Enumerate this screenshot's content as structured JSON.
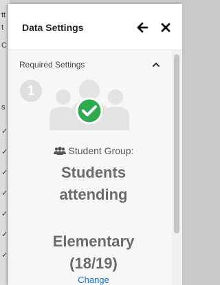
{
  "panel": {
    "title": "Data Settings",
    "back_icon": "arrow-left-icon",
    "close_icon": "close-icon"
  },
  "section": {
    "label": "Required Settings",
    "collapse_icon": "chevron-up-icon",
    "step_number": "1",
    "status_icon": "check-circle-icon",
    "group_icon": "users-icon"
  },
  "student_group": {
    "label": "Student Group:",
    "value_line1": "Students",
    "value_line2": "attending",
    "value_line3": "Elementary",
    "value_line4": "(18/19)",
    "change_label": "Change"
  },
  "colors": {
    "accent": "#1a73c8",
    "success": "#2eaa4f",
    "icon_gray": "#e3e3e3",
    "text_gray": "#6a6a6a"
  }
}
